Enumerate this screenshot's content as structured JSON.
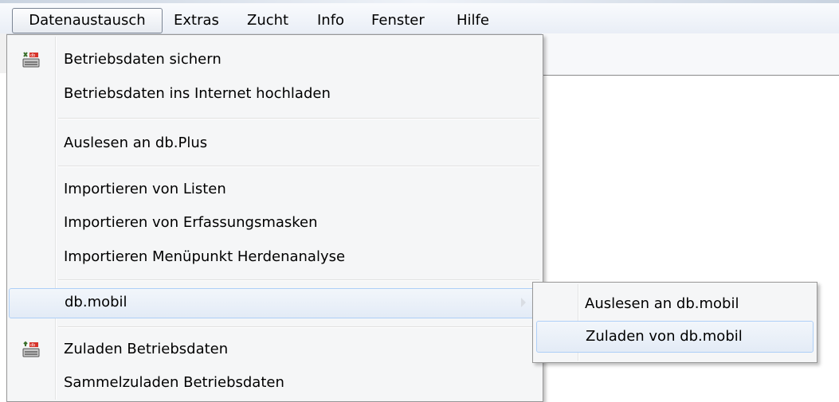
{
  "menubar": {
    "items": [
      {
        "label": "Datenaustausch"
      },
      {
        "label": "Extras"
      },
      {
        "label": "Zucht"
      },
      {
        "label": "Info"
      },
      {
        "label": "Fenster"
      },
      {
        "label": "Hilfe"
      }
    ]
  },
  "dropdown": {
    "items": [
      {
        "label": "Betriebsdaten sichern",
        "icon": "save-data-icon"
      },
      {
        "label": "Betriebsdaten ins Internet hochladen"
      },
      {
        "label": "Auslesen an db.Plus"
      },
      {
        "label": "Importieren von Listen"
      },
      {
        "label": "Importieren von Erfassungsmasken"
      },
      {
        "label": "Importieren Menüpunkt Herdenanalyse"
      },
      {
        "label": "db.mobil"
      },
      {
        "label": "Zuladen Betriebsdaten",
        "icon": "load-data-icon"
      },
      {
        "label": "Sammelzuladen Betriebsdaten"
      }
    ]
  },
  "submenu": {
    "items": [
      {
        "label": "Auslesen an db.mobil"
      },
      {
        "label": "Zuladen von db.mobil"
      }
    ]
  },
  "colors": {
    "hover_border": "#aecff7",
    "menu_background": "#f5f6f7"
  }
}
